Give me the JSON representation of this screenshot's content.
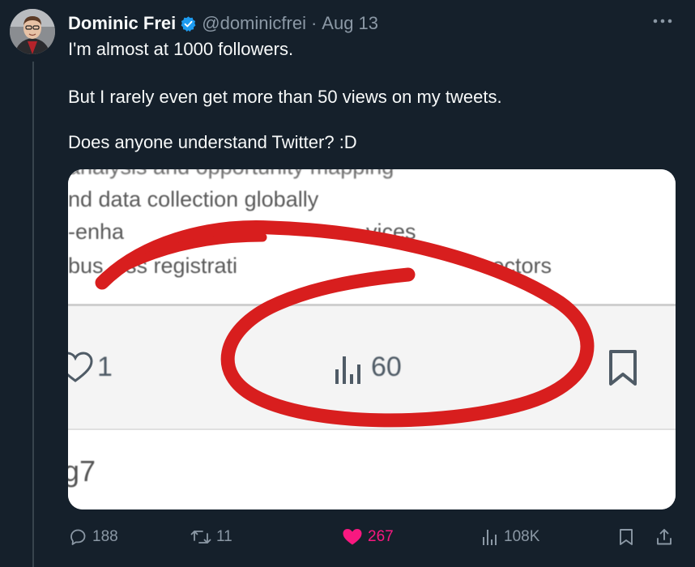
{
  "author": {
    "display_name": "Dominic Frei",
    "handle": "@dominicfrei",
    "separator": "·",
    "date": "Aug 13"
  },
  "tweet": {
    "lines": [
      "I'm almost at 1000 followers.",
      "But I rarely even get more than 50 views on my tweets.",
      "Does anyone understand Twitter? :D"
    ]
  },
  "media": {
    "cropped_top_text": "analysis and opportunity mapping",
    "line1": "nd data collection globally",
    "line2": "-enha",
    "line2_tail": "vices",
    "line3": "bus",
    "line3_b": "ess registrati",
    "line3_tail": "sectors",
    "like_count": "1",
    "views_count": "60",
    "bottom_text": "g7",
    "annotation_color": "#d81e1e"
  },
  "actions": {
    "reply_count": "188",
    "retweet_count": "11",
    "like_count": "267",
    "views_count": "108K"
  },
  "colors": {
    "background": "#15202b",
    "text": "#f7f9f9",
    "muted": "#8b98a5",
    "verified": "#1d9bf0",
    "like": "#f91880"
  },
  "icons": [
    "verified-badge-icon",
    "more-icon",
    "reply-icon",
    "retweet-icon",
    "heart-icon",
    "views-icon",
    "bookmark-icon",
    "share-icon"
  ]
}
